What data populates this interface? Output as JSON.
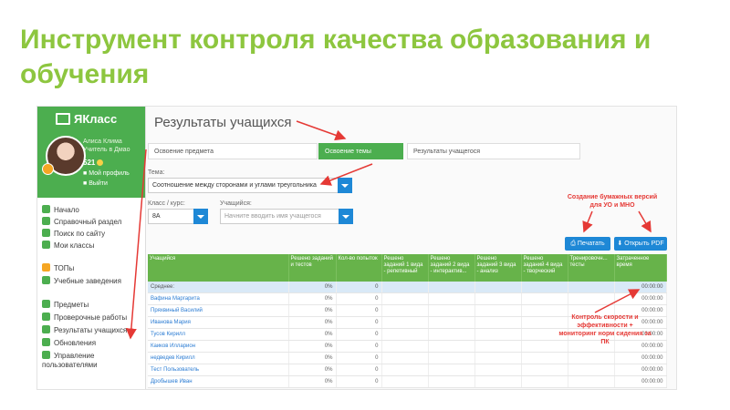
{
  "slide": {
    "title": "Инструмент контроля качества образования и обучения"
  },
  "app": {
    "logo": "ЯКласс",
    "user": {
      "name": "Алиса Клима",
      "role": "Учитель в Дмао",
      "score": "521",
      "profile": "Мой профиль",
      "logout": "Выйти"
    },
    "nav": [
      {
        "label": "Начало",
        "icon": "home-icon",
        "color": "#4cae4f"
      },
      {
        "label": "Справочный раздел",
        "icon": "info-icon",
        "color": "#4cae4f"
      },
      {
        "label": "Поиск по сайту",
        "icon": "search-icon",
        "color": "#4cae4f"
      },
      {
        "label": "Мои классы",
        "icon": "users-icon",
        "color": "#4cae4f"
      },
      {
        "label": "ТОПы",
        "icon": "trophy-icon",
        "color": "#f5a623"
      },
      {
        "label": "Учебные заведения",
        "icon": "school-icon",
        "color": "#4cae4f"
      },
      {
        "label": "Предметы",
        "icon": "book-icon",
        "color": "#4cae4f"
      },
      {
        "label": "Проверочные работы",
        "icon": "check-icon",
        "color": "#4cae4f"
      },
      {
        "label": "Результаты учащихся",
        "icon": "chart-icon",
        "color": "#4cae4f"
      },
      {
        "label": "Обновления",
        "icon": "refresh-icon",
        "color": "#4cae4f"
      },
      {
        "label": "Управление пользователями",
        "icon": "user-manage-icon",
        "color": "#4cae4f"
      }
    ]
  },
  "main": {
    "title": "Результаты учащихся",
    "tabs": [
      "Освоение предмета",
      "Освоение темы",
      "Результаты учащегося"
    ],
    "topic_label": "Тема:",
    "topic_value": "Соотношение между сторонами и углами треугольника",
    "class_label": "Класс / курс:",
    "class_value": "8А",
    "student_label": "Учащийся:",
    "student_placeholder": "Начните вводить имя учащегося",
    "print_button": "Печатать",
    "pdf_button": "Открыть PDF"
  },
  "table": {
    "headers": [
      "Учащийся",
      "Решено заданий и тестов",
      "Кол-во попыток",
      "Решено заданий 1 вида - репетивный",
      "Решено заданий 2 вида - интерактив...",
      "Решено заданий 3 вида - анализ",
      "Решено заданий 4 вида - творческий",
      "Тренировочн... тесты",
      "Затраченное время"
    ],
    "rows": [
      {
        "name": "Среднее:",
        "solved": "0%",
        "attempts": "0",
        "time": "00:00:00",
        "avg": true
      },
      {
        "name": "Вафина Маргарита",
        "solved": "0%",
        "attempts": "0",
        "time": "00:00:00"
      },
      {
        "name": "Пряхвиный Василий",
        "solved": "0%",
        "attempts": "0",
        "time": "00:00:00"
      },
      {
        "name": "Иванова Мария",
        "solved": "0%",
        "attempts": "0",
        "time": "00:00:00"
      },
      {
        "name": "Тусов Кирилл",
        "solved": "0%",
        "attempts": "0",
        "time": "00:00:00"
      },
      {
        "name": "Каиков Илларион",
        "solved": "0%",
        "attempts": "0",
        "time": "00:00:00"
      },
      {
        "name": "недведев Кирилл",
        "solved": "0%",
        "attempts": "0",
        "time": "00:00:00"
      },
      {
        "name": "Тест Пользователь",
        "solved": "0%",
        "attempts": "0",
        "time": "00:00:00"
      },
      {
        "name": "Дробышев Иван",
        "solved": "0%",
        "attempts": "0",
        "time": "00:00:00"
      }
    ]
  },
  "annotations": {
    "paper": "Создание бумажных версий для УО и МНО",
    "speed": "Контроль скорости и эффективности + мониторинг норм сидения за ПК"
  },
  "colors": {
    "accent": "#8dc63f",
    "green": "#4cae4f",
    "blue": "#1e88d6",
    "annotation": "#e53935"
  }
}
